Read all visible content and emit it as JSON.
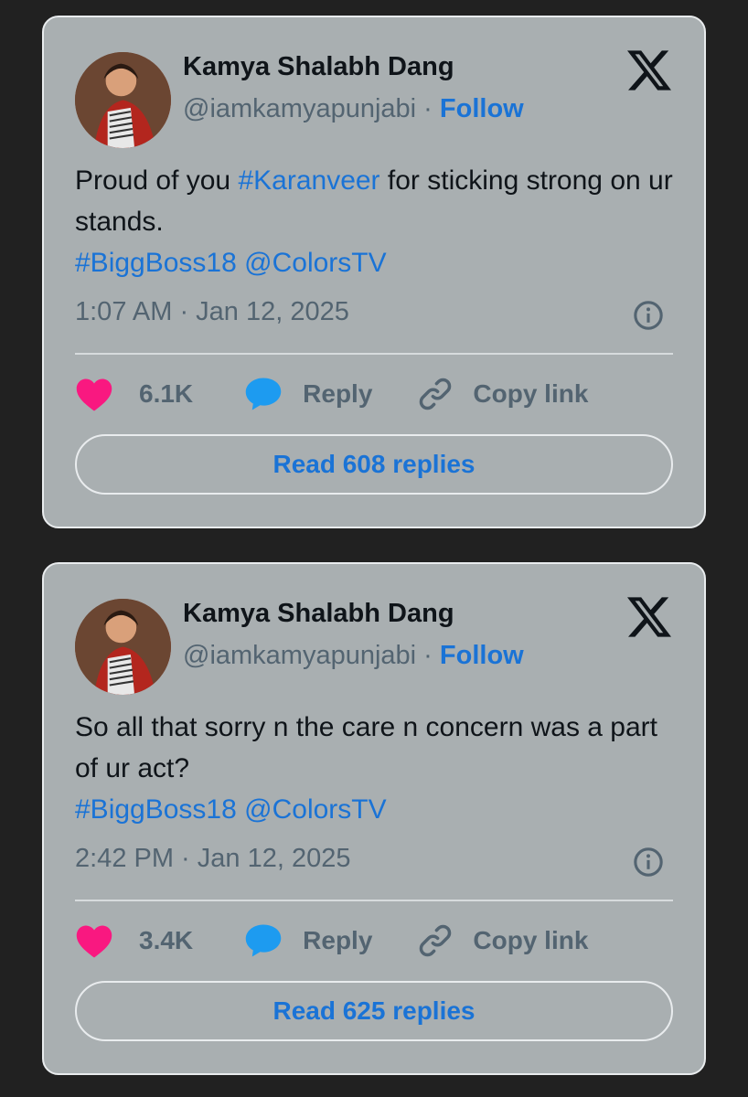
{
  "tweets": [
    {
      "author_name": "Kamya Shalabh Dang",
      "handle": "@iamkamyapunjabi",
      "separator": "·",
      "follow_label": "Follow",
      "text_line1_a": "Proud of you ",
      "text_line1_tag": "#Karanveer",
      "text_line1_b": " for sticking strong on ur stands.",
      "text_line2_tag1": "#BiggBoss18",
      "text_line2_tag2": "@ColorsTV",
      "timestamp": "1:07 AM · Jan 12, 2025",
      "likes": "6.1K",
      "reply_label": "Reply",
      "copy_link_label": "Copy link",
      "read_replies_label": "Read 608 replies"
    },
    {
      "author_name": "Kamya Shalabh Dang",
      "handle": "@iamkamyapunjabi",
      "separator": "·",
      "follow_label": "Follow",
      "text_line1_a": "So all that sorry n the care n concern was a part of ur act?",
      "text_line1_tag": "",
      "text_line1_b": "",
      "text_line2_tag1": "#BiggBoss18",
      "text_line2_tag2": "@ColorsTV",
      "timestamp": "2:42 PM · Jan 12, 2025",
      "likes": "3.4K",
      "reply_label": "Reply",
      "copy_link_label": "Copy link",
      "read_replies_label": "Read 625 replies"
    }
  ],
  "icons": {
    "logo": "x-logo-icon",
    "info": "info-icon",
    "like": "heart-icon",
    "reply": "speech-bubble-icon",
    "copy_link": "link-icon"
  },
  "colors": {
    "background": "#212121",
    "card": "#a9afb1",
    "link": "#1a73d6",
    "heart": "#f91880",
    "reply_bubble": "#1d9bf0",
    "muted": "#536471"
  }
}
